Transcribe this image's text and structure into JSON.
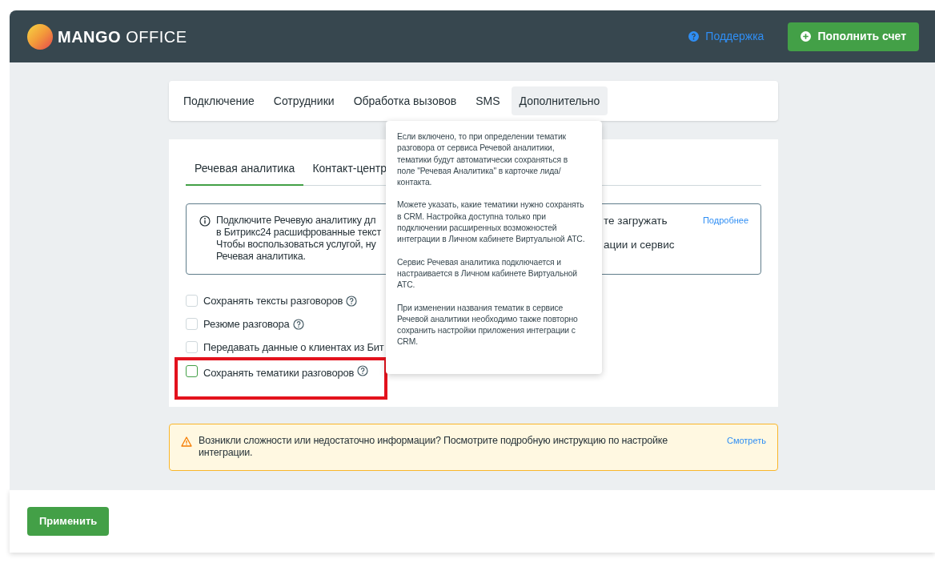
{
  "header": {
    "logo": {
      "bold": "MANGO",
      "light": "OFFICE"
    },
    "support_link": "Поддержка",
    "topup_button": "Пополнить счет"
  },
  "nav_tabs": [
    {
      "label": "Подключение",
      "selected": false
    },
    {
      "label": "Сотрудники",
      "selected": false
    },
    {
      "label": "Обработка вызовов",
      "selected": false
    },
    {
      "label": "SMS",
      "selected": false
    },
    {
      "label": "Дополнительно",
      "selected": true
    }
  ],
  "sub_tabs": [
    {
      "label": "Речевая аналитика",
      "selected": true
    },
    {
      "label": "Контакт-центр",
      "selected": false
    }
  ],
  "info_box": {
    "lines": [
      {
        "left": "Подключите Речевую аналитику дл",
        "right": "те загружать"
      },
      {
        "left": "в Битрикс24 расшифрованные текст"
      },
      {
        "left": "Чтобы воспользоваться услугой, ну",
        "right": "ации и сервис"
      },
      {
        "left": "Речевая аналитика."
      }
    ],
    "link": "Подробнее"
  },
  "options": [
    {
      "label": "Сохранять тексты разговоров",
      "checked": false,
      "help": true,
      "highlighted": false
    },
    {
      "label": "Резюме разговора",
      "checked": false,
      "help": true,
      "highlighted": false
    },
    {
      "label": "Передавать данные о клиентах из Бит",
      "checked": false,
      "help": false,
      "highlighted": false
    },
    {
      "label": "Сохранять тематики разговоров",
      "checked": false,
      "help": true,
      "highlighted": true
    }
  ],
  "tooltip": [
    "Если включено, то при определении тематик разговора от сервиса Речевой аналитики, тематики будут автоматически сохраняться в поле \"Речевая Аналитика\" в карточке лида/ контакта.",
    "Можете указать, какие тематики нужно сохранять в CRM. Настройка доступна только при подключении расширенных возможностей интеграции в Личном кабинете Виртуальной АТС.",
    "Сервис Речевая аналитика подключается и настраивается в Личном кабинете Виртуальной АТС.",
    "При изменении названия тематик в сервисе Речевой аналитики необходимо также повторно сохранить настройки приложения интеграции с CRM."
  ],
  "warning": {
    "text": "Возникли сложности или недостаточно информации? Посмотрите подробную инструкцию по настройке интеграции.",
    "link": "Смотреть"
  },
  "apply_button": "Применить"
}
